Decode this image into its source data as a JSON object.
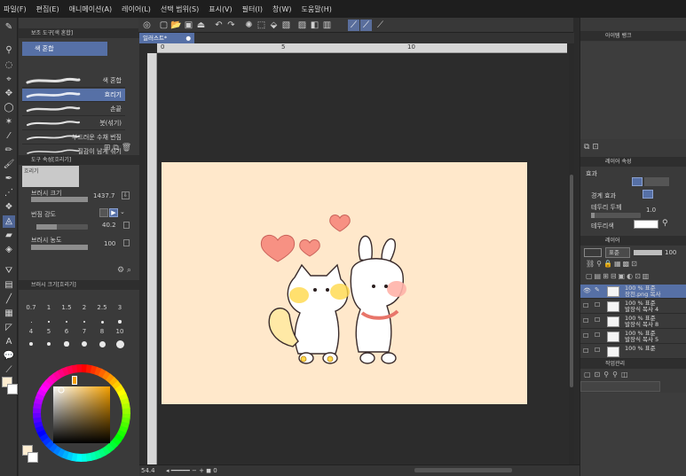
{
  "menu": [
    "파일(F)",
    "편집(E)",
    "애니메이션(A)",
    "레이어(L)",
    "선택 범위(S)",
    "표시(V)",
    "필터(I)",
    "창(W)",
    "도움말(H)"
  ],
  "canvas_tab": {
    "label": "일러스트*"
  },
  "ruler": {
    "marks": [
      "0",
      "5",
      "10"
    ]
  },
  "subtool": {
    "panel_title": "보조 도구[색 혼합]",
    "group": "색 혼합",
    "brushes": [
      {
        "label": "색 혼합",
        "selected": false
      },
      {
        "label": "흐리기",
        "selected": true
      },
      {
        "label": "손끝",
        "selected": false
      },
      {
        "label": "붓(섞기)",
        "selected": false
      },
      {
        "label": "부드러운 수채 번짐",
        "selected": false
      },
      {
        "label": "질감이 남게 섞기",
        "selected": false
      }
    ]
  },
  "tool_property": {
    "panel_title": "도구 속성[흐리기]",
    "preview_label": "흐리기",
    "brush_size_label": "브러시 크기",
    "brush_size_value": "1437.7",
    "blur_strength_label": "번짐 강도",
    "blur_strength_value": "40.2",
    "brush_density_label": "브러시 농도",
    "brush_density_value": "100"
  },
  "brush_size_panel": {
    "panel_title": "브러시 크기[흐리기]",
    "row1": [
      "0.7",
      "1",
      "1.5",
      "2",
      "2.5",
      "3"
    ],
    "row2": [
      "4",
      "5",
      "6",
      "7",
      "8",
      "10"
    ]
  },
  "color": {
    "rgb_r": "255",
    "rgb_g": "238",
    "rgb_b": "210",
    "main": "#ffeed2",
    "sub": "#ffffff"
  },
  "navigator": {
    "panel_title": "아이템 뱅크"
  },
  "layer_property": {
    "panel_title": "레이어 속성",
    "effect_label": "효과",
    "border_effect_label": "경계 효과",
    "edge_width_label": "테두리 두께",
    "edge_width_value": "1.0",
    "edge_color_label": "테두리색",
    "edge_color": "#ffffff"
  },
  "layers": {
    "panel_title": "레이어",
    "blend_mode": "표준",
    "opacity": "100",
    "items": [
      {
        "line1": "100 % 표준",
        "line2": "장천.png 복사",
        "selected": true
      },
      {
        "line1": "100 % 표준",
        "line2": "발장식 복사 4",
        "selected": false
      },
      {
        "line1": "100 % 표준",
        "line2": "발장식 복사 8",
        "selected": false
      },
      {
        "line1": "100 % 표준",
        "line2": "발장식 복사 5",
        "selected": false
      },
      {
        "line1": "100 % 표준",
        "line2": "",
        "selected": false
      }
    ]
  },
  "task_panel": {
    "panel_title": "작업관리"
  },
  "status": {
    "zoom": "54.4"
  }
}
